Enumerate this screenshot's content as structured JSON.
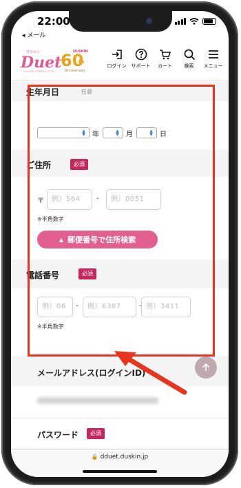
{
  "status_bar": {
    "time": "22:00",
    "back_label": "◂ メール"
  },
  "header": {
    "logo_sub": "ダスキン",
    "logo_text": "Duet",
    "logo_tagline": "DUSKIN PARENT SITE",
    "anniversary": {
      "brand": "DUSKIN",
      "number": "60",
      "suffix": "th",
      "text": "Anniversary"
    },
    "nav": [
      {
        "label": "ログイン",
        "icon": "login-icon"
      },
      {
        "label": "サポート",
        "icon": "question-circle-icon"
      },
      {
        "label": "カート",
        "icon": "cart-icon"
      },
      {
        "label": "検索",
        "icon": "search-icon"
      },
      {
        "label": "メニュー",
        "icon": "hamburger-menu-icon"
      }
    ]
  },
  "form": {
    "birthdate": {
      "label": "生年月日",
      "optional": "任意",
      "year_unit": "年",
      "month_unit": "月",
      "day_unit": "日"
    },
    "address": {
      "label": "ご住所",
      "required": "必須",
      "postal_mark": "〒",
      "postal1_placeholder": "例）564",
      "postal2_placeholder": "例）0051",
      "note": "※半角数字",
      "search_button": "郵便番号で住所検索"
    },
    "phone": {
      "label": "電話番号",
      "required": "必須",
      "p1_placeholder": "例）06",
      "p2_placeholder": "例）6387",
      "p3_placeholder": "例）3411",
      "note": "※半角数字"
    },
    "email": {
      "label": "メールアドレス(ログインID)"
    },
    "password": {
      "label": "パスワード",
      "required": "必須"
    }
  },
  "browser": {
    "url": "dduet.duskin.jp"
  },
  "colors": {
    "accent_pink": "#e35f90",
    "required_badge": "#c4265e",
    "annotation_red": "#e8341c"
  }
}
